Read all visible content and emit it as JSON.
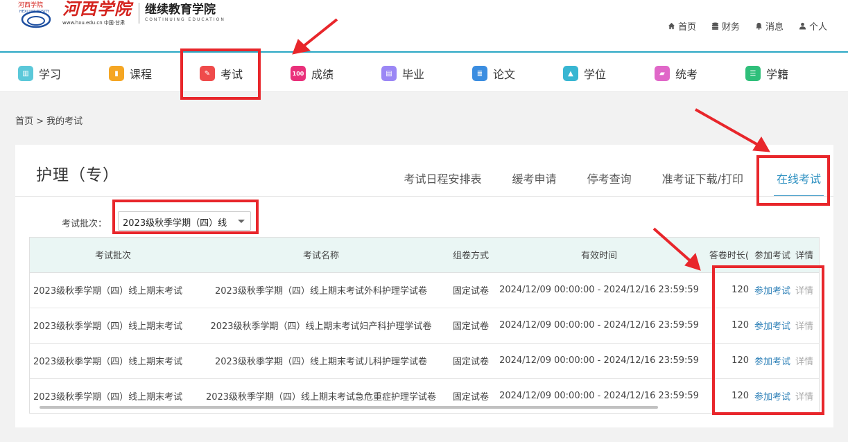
{
  "logo": {
    "seal_text": "河西学院",
    "seal_univ": "HEXI UNIVERSITY",
    "calligraphy": "河西学院",
    "url": "www.hxu.edu.cn 中国·甘肃",
    "college_cn": "继续教育学院",
    "college_en": "CONTINUING EDUCATION"
  },
  "top_links": [
    {
      "label": "首页",
      "icon": "home-icon"
    },
    {
      "label": "财务",
      "icon": "database-icon"
    },
    {
      "label": "消息",
      "icon": "bell-icon"
    },
    {
      "label": "个人",
      "icon": "user-icon"
    }
  ],
  "nav": [
    {
      "label": "学习",
      "icon": "book-icon",
      "color": "#5bc8d9"
    },
    {
      "label": "课程",
      "icon": "bookmark-icon",
      "color": "#f5a623"
    },
    {
      "label": "考试",
      "icon": "edit-icon",
      "color": "#ef4b4b"
    },
    {
      "label": "成绩",
      "icon": "score-icon",
      "color": "#e9307a",
      "glyph": "100"
    },
    {
      "label": "毕业",
      "icon": "graduate-card-icon",
      "color": "#9b87f5"
    },
    {
      "label": "论文",
      "icon": "document-icon",
      "color": "#3b8de0"
    },
    {
      "label": "学位",
      "icon": "cap-icon",
      "color": "#38b6d2"
    },
    {
      "label": "统考",
      "icon": "folder-icon",
      "color": "#e067c8"
    },
    {
      "label": "学籍",
      "icon": "list-icon",
      "color": "#2fbf7a"
    }
  ],
  "breadcrumb": "首页 > 我的考试",
  "card": {
    "title": "护理（专）",
    "tabs": [
      "考试日程安排表",
      "缓考申请",
      "停考查询",
      "准考证下载/打印",
      "在线考试"
    ],
    "active_tab": "在线考试",
    "batch_label": "考试批次：",
    "batch_value": "2023级秋季学期（四）线"
  },
  "table": {
    "headers": [
      "考试批次",
      "考试名称",
      "组卷方式",
      "有效时间",
      "答卷时长(",
      "参加考试",
      "详情"
    ],
    "rows": [
      [
        "2023级秋季学期（四）线上期末考试",
        "2023级秋季学期（四）线上期末考试外科护理学试卷",
        "固定试卷",
        "2024/12/09 00:00:00 - 2024/12/16 23:59:59",
        "120",
        "参加考试",
        "详情"
      ],
      [
        "2023级秋季学期（四）线上期末考试",
        "2023级秋季学期（四）线上期末考试妇产科护理学试卷",
        "固定试卷",
        "2024/12/09 00:00:00 - 2024/12/16 23:59:59",
        "120",
        "参加考试",
        "详情"
      ],
      [
        "2023级秋季学期（四）线上期末考试",
        "2023级秋季学期（四）线上期末考试儿科护理学试卷",
        "固定试卷",
        "2024/12/09 00:00:00 - 2024/12/16 23:59:59",
        "120",
        "参加考试",
        "详情"
      ],
      [
        "2023级秋季学期（四）线上期末考试",
        "2023级秋季学期（四）线上期末考试急危重症护理学试卷",
        "固定试卷",
        "2024/12/09 00:00:00 - 2024/12/16 23:59:59",
        "120",
        "参加考试",
        "详情"
      ]
    ]
  },
  "colors": {
    "accent": "#2b8fc0",
    "header_line": "#2aa7c4",
    "annotation": "#e8262b",
    "table_header_bg": "#eaf6f4"
  }
}
